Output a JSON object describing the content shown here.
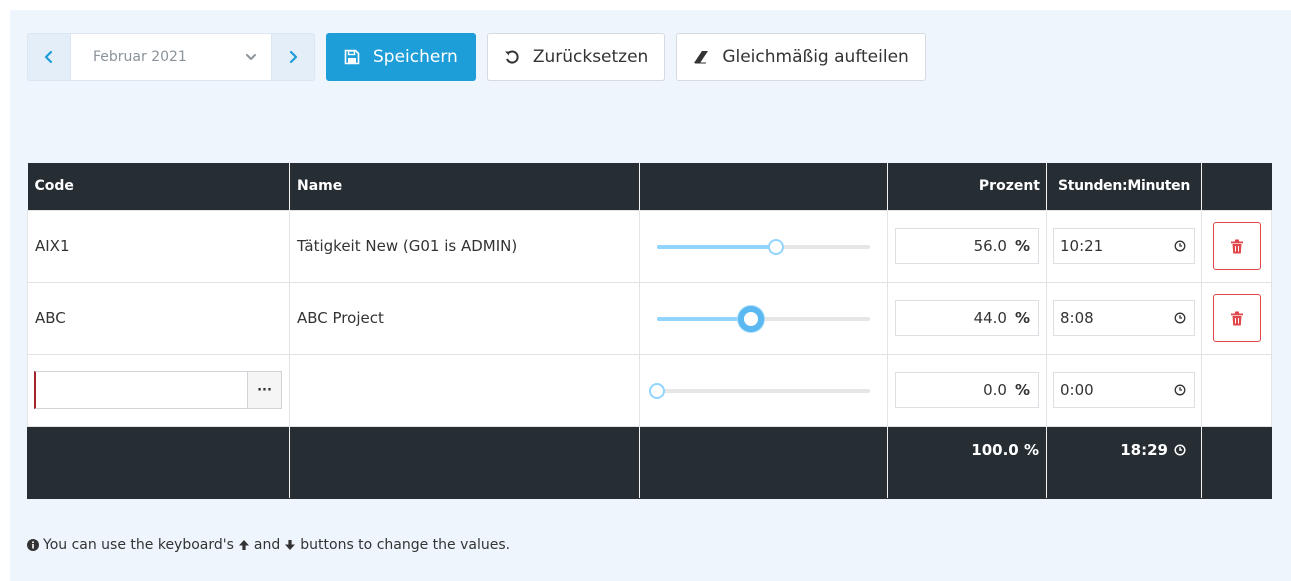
{
  "toolbar": {
    "month": "Februar 2021",
    "save_label": "Speichern",
    "reset_label": "Zurücksetzen",
    "split_label": "Gleichmäßig aufteilen"
  },
  "table": {
    "headers": {
      "code": "Code",
      "name": "Name",
      "slider": "",
      "percent": "Prozent",
      "time": "Stunden:Minuten",
      "action": ""
    },
    "rows": [
      {
        "code": "AIX1",
        "name": "Tätigkeit New (G01 is ADMIN)",
        "percent": "56.0",
        "percent_value": 56.0,
        "time": "10:21"
      },
      {
        "code": "ABC",
        "name": "ABC Project",
        "percent": "44.0",
        "percent_value": 44.0,
        "time": "8:08"
      }
    ],
    "new_row": {
      "code_value": "",
      "more_label": "···",
      "percent": "0.0",
      "percent_value": 0.0,
      "time": "0:00"
    },
    "percent_unit": "%",
    "footer": {
      "total_percent": "100.0 %",
      "total_time": "18:29"
    }
  },
  "hint": {
    "part1": "You can use the keyboard's",
    "part2": "and",
    "part3": "buttons to change the values."
  },
  "colors": {
    "primary": "#1e9ed8",
    "header_bg": "#262d33",
    "danger": "#e0464a",
    "slider": "#91d5ff",
    "panel_bg": "#eef5fd"
  },
  "icons": [
    "chevron-left-icon",
    "chevron-down-icon",
    "chevron-right-icon",
    "floppy-disk-icon",
    "undo-icon",
    "eraser-icon",
    "trash-icon",
    "clock-icon",
    "info-icon",
    "arrow-up-icon",
    "arrow-down-icon"
  ]
}
